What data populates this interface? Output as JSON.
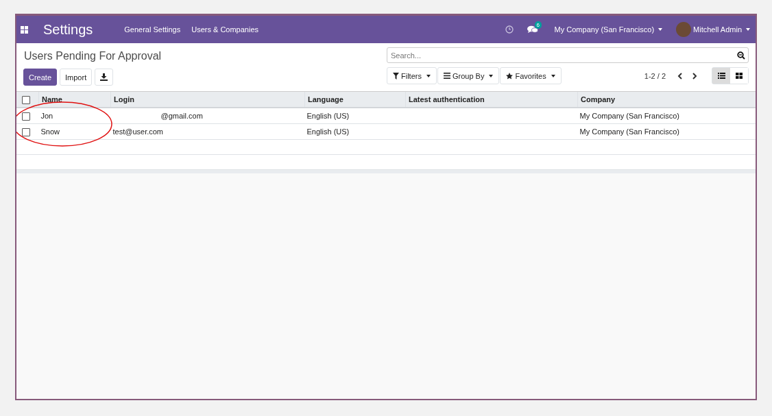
{
  "navbar": {
    "app_title": "Settings",
    "menu": [
      "General Settings",
      "Users & Companies"
    ],
    "messages_badge": "6",
    "company": "My Company (San Francisco)",
    "user": "Mitchell Admin"
  },
  "control_panel": {
    "title": "Users Pending For Approval",
    "buttons": [
      "Create",
      "Import"
    ],
    "search": {
      "placeholder": "Search..."
    },
    "filters": [
      "Filters",
      "Group By",
      "Favorites"
    ],
    "pager": "1-2 / 2",
    "views": [
      {
        "kind": "list",
        "selected": true
      },
      {
        "kind": "kanban",
        "selected": false
      }
    ]
  },
  "table": {
    "header_checked": false,
    "columns": [
      "Name",
      "Login",
      "Language",
      "Latest authentication",
      "Company"
    ],
    "rows": [
      {
        "checked": false,
        "cells": [
          "Jon",
          "@gmail.com",
          "English (US)",
          "",
          "My Company (San Francisco)"
        ],
        "login_redacted": true
      },
      {
        "checked": false,
        "cells": [
          "Snow",
          "test@user.com",
          "English (US)",
          "",
          "My Company (San Francisco)"
        ],
        "login_redacted": false
      }
    ]
  },
  "annotation": {
    "kind": "ellipse"
  }
}
